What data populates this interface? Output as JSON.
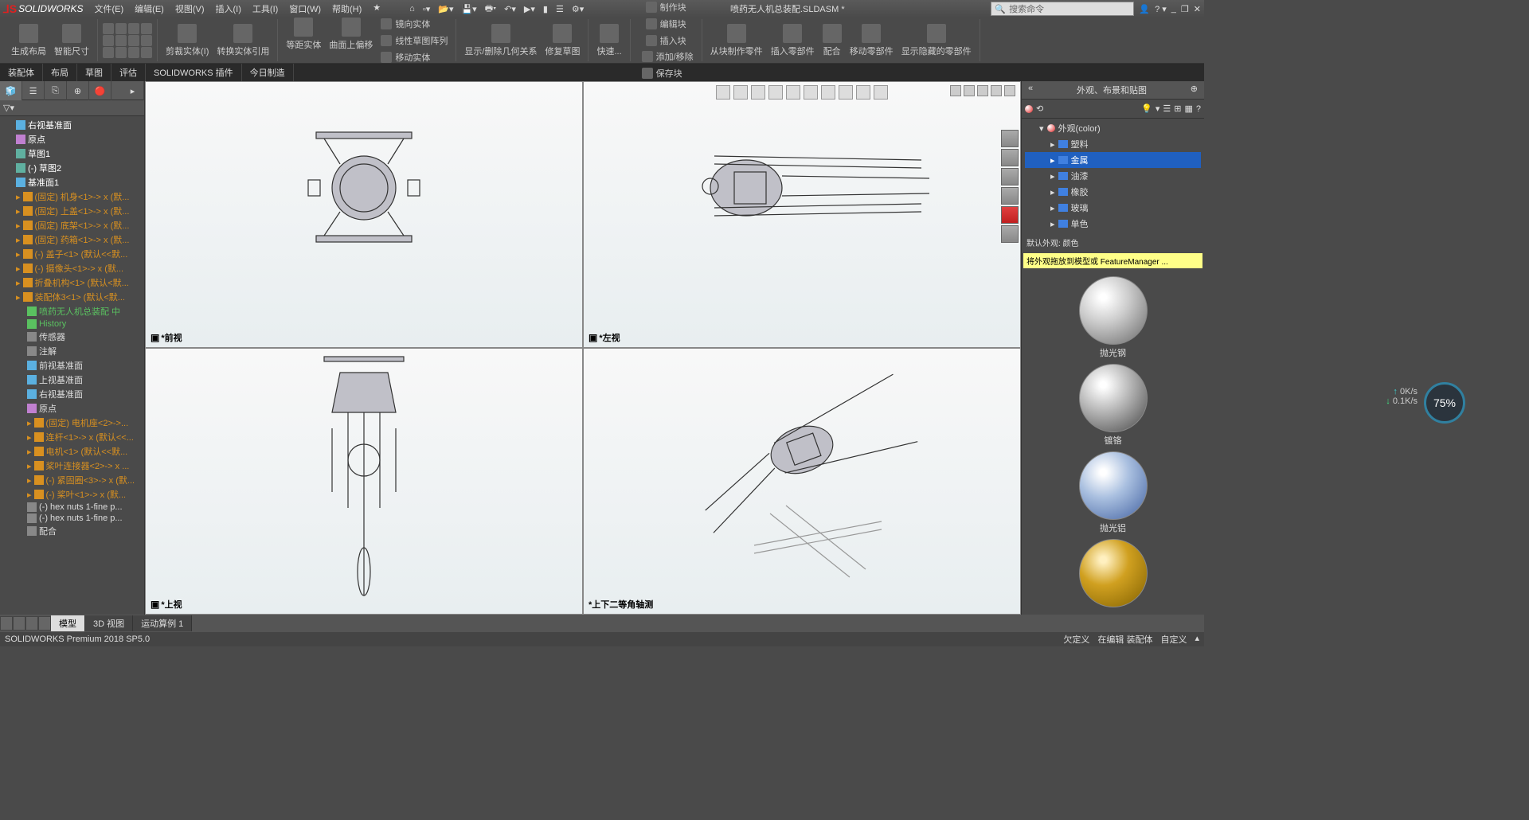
{
  "app": {
    "name": "SOLIDWORKS",
    "document_title": "喷药无人机总装配.SLDASM *",
    "search_placeholder": "搜索命令"
  },
  "menu": [
    "文件(E)",
    "编辑(E)",
    "视图(V)",
    "插入(I)",
    "工具(I)",
    "窗口(W)",
    "帮助(H)"
  ],
  "ribbon": {
    "group1": {
      "btn1": "生成布局",
      "btn2": "智能尺寸"
    },
    "group3": {
      "btn1": "剪裁实体(I)",
      "btn2": "转换实体引用"
    },
    "group4": {
      "btn1": "等距实体",
      "btn2": "曲面上偏移",
      "b3": "镜向实体",
      "b4": "线性草图阵列",
      "b5": "移动实体"
    },
    "group5": {
      "btn1": "显示/删除几何关系",
      "btn2": "修复草图"
    },
    "group6": {
      "btn1": "快速..."
    },
    "group7": {
      "b1": "制作块",
      "b2": "编辑块",
      "b3": "插入块",
      "b4": "添加/移除",
      "b5": "保存块"
    },
    "group8": {
      "btn1": "从块制作零件",
      "btn2": "插入零部件",
      "btn3": "配合",
      "btn4": "移动零部件",
      "btn5": "显示隐藏的零部件"
    }
  },
  "tabs": [
    "装配体",
    "布局",
    "草图",
    "评估",
    "SOLIDWORKS 插件",
    "今日制造"
  ],
  "tree": [
    {
      "l": "右视基准面",
      "t": "plane",
      "d": 0
    },
    {
      "l": "原点",
      "t": "origin",
      "d": 0
    },
    {
      "l": "草图1",
      "t": "sketch",
      "d": 0
    },
    {
      "l": "(-) 草图2",
      "t": "sketch",
      "d": 0
    },
    {
      "l": "基准面1",
      "t": "plane",
      "d": 0
    },
    {
      "l": "(固定) 机身<1>-> x (默...",
      "t": "comp",
      "d": 0
    },
    {
      "l": "(固定) 上盖<1>-> x (默...",
      "t": "comp",
      "d": 0
    },
    {
      "l": "(固定) 底架<1>-> x (默...",
      "t": "comp",
      "d": 0
    },
    {
      "l": "(固定) 药箱<1>-> x (默...",
      "t": "comp",
      "d": 0
    },
    {
      "l": "(-) 盖子<1> (默认<<默...",
      "t": "comp",
      "d": 0
    },
    {
      "l": "(-) 摄像头<1>-> x (默...",
      "t": "comp",
      "d": 0
    },
    {
      "l": "折叠机构<1> (默认<默...",
      "t": "comp",
      "d": 0
    },
    {
      "l": "装配体3<1> (默认<默...",
      "t": "comp",
      "d": 0
    },
    {
      "l": "喷药无人机总装配 中",
      "t": "sub-green",
      "d": 1
    },
    {
      "l": "History",
      "t": "sub-green",
      "d": 1
    },
    {
      "l": "传感器",
      "t": "sub-folder",
      "d": 1
    },
    {
      "l": "注解",
      "t": "sub-folder",
      "d": 1
    },
    {
      "l": "前视基准面",
      "t": "sub-plane",
      "d": 1
    },
    {
      "l": "上视基准面",
      "t": "sub-plane",
      "d": 1
    },
    {
      "l": "右视基准面",
      "t": "sub-plane",
      "d": 1
    },
    {
      "l": "原点",
      "t": "sub-origin",
      "d": 1
    },
    {
      "l": "(固定) 电机座<2>->...",
      "t": "comp2",
      "d": 1
    },
    {
      "l": "连杆<1>-> x (默认<<...",
      "t": "comp2",
      "d": 1
    },
    {
      "l": "电机<1> (默认<<默...",
      "t": "comp2",
      "d": 1
    },
    {
      "l": "桨叶连接器<2>-> x ...",
      "t": "comp2",
      "d": 1
    },
    {
      "l": "(-) 紧固圈<3>-> x (默...",
      "t": "comp2",
      "d": 1
    },
    {
      "l": "(-) 桨叶<1>-> x (默...",
      "t": "comp2",
      "d": 1
    },
    {
      "l": "(-) hex nuts 1-fine p...",
      "t": "sub-part",
      "d": 1
    },
    {
      "l": "(-) hex nuts 1-fine p...",
      "t": "sub-part",
      "d": 1
    },
    {
      "l": "配合",
      "t": "sub-mate",
      "d": 1
    }
  ],
  "views": {
    "v1": "*前视",
    "v2": "*左视",
    "v3": "*上视",
    "v4": "*上下二等角轴测"
  },
  "right_panel": {
    "title": "外观、布景和贴图",
    "root": "外观(color)",
    "items": [
      "塑料",
      "金属",
      "油漆",
      "橡胶",
      "玻璃",
      "单色"
    ],
    "selected_idx": 1,
    "hint_title": "默认外观: 颜色",
    "hint_body": "将外观拖放到模型或 FeatureManager ...",
    "swatches": [
      "抛光钢",
      "镀铬",
      "抛光铝",
      ""
    ]
  },
  "bottom_tabs": [
    "模型",
    "3D 视图",
    "运动算例 1"
  ],
  "status": {
    "left": "SOLIDWORKS Premium 2018 SP5.0",
    "r1": "欠定义",
    "r2": "在编辑 装配体",
    "r3": "自定义"
  },
  "net": {
    "up": "0K/s",
    "down": "0.1K/s",
    "pct": "75%"
  }
}
